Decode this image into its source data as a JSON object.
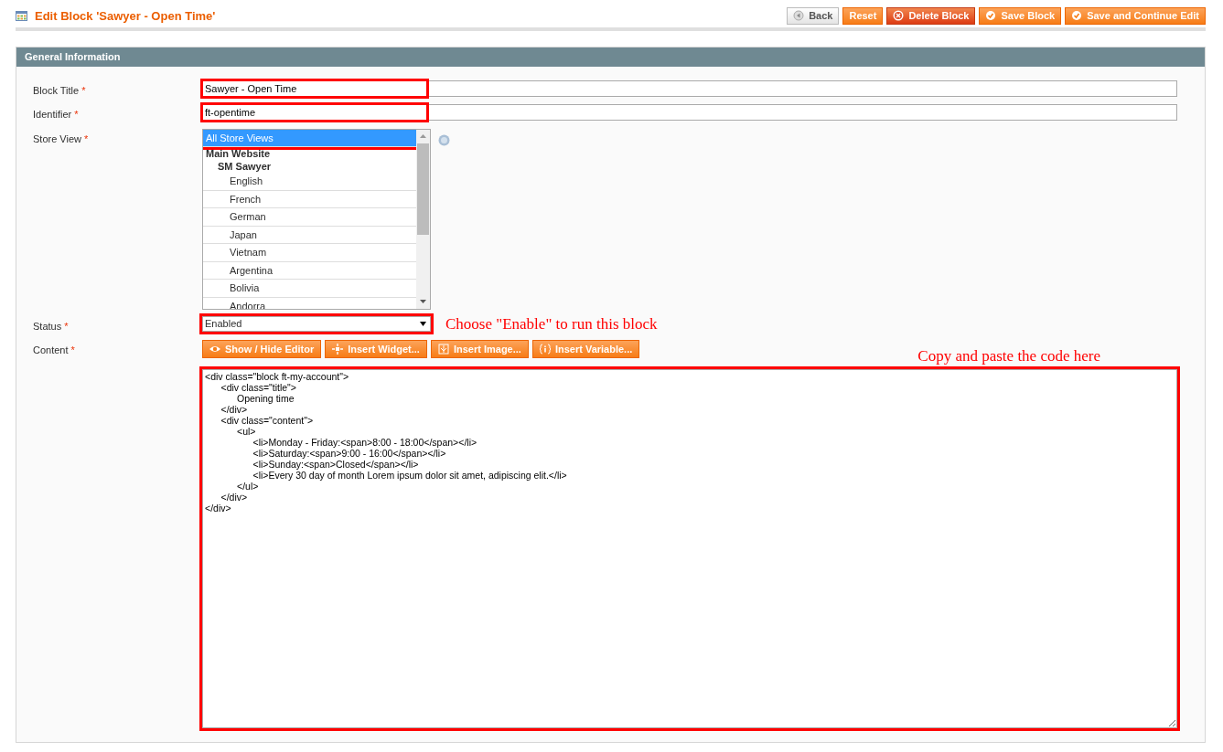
{
  "page": {
    "title": "Edit Block 'Sawyer - Open Time'"
  },
  "header_buttons": [
    {
      "label": "Back",
      "kind": "back"
    },
    {
      "label": "Reset",
      "kind": "plain"
    },
    {
      "label": "Delete Block",
      "kind": "delete"
    },
    {
      "label": "Save Block",
      "kind": "save"
    },
    {
      "label": "Save and Continue Edit",
      "kind": "save"
    }
  ],
  "section": {
    "title": "General Information",
    "fields": [
      {
        "kind": "text",
        "label": "Block Title",
        "required": "*",
        "value": "Sawyer - Open Time",
        "highlighted": true
      },
      {
        "kind": "text",
        "label": "Identifier",
        "required": "*",
        "value": "ft-opentime",
        "highlighted": true
      },
      {
        "kind": "multiselect",
        "label": "Store View",
        "required": "*",
        "options": [
          {
            "label": "All Store Views",
            "selected": true,
            "highlighted": true
          },
          {
            "label": "Main Website",
            "kind": "group",
            "children": [
              {
                "label": "SM Sawyer",
                "kind": "group",
                "children": [
                  {
                    "label": "English",
                    "selected": false
                  },
                  {
                    "label": "French",
                    "selected": false
                  },
                  {
                    "label": "German",
                    "selected": false
                  },
                  {
                    "label": "Japan",
                    "selected": false
                  },
                  {
                    "label": "Vietnam",
                    "selected": false
                  },
                  {
                    "label": "Argentina",
                    "selected": false
                  },
                  {
                    "label": "Bolivia",
                    "selected": false
                  },
                  {
                    "label": "Andorra",
                    "selected": false
                  }
                ]
              }
            ]
          }
        ]
      },
      {
        "kind": "select",
        "label": "Status",
        "required": "*",
        "value": "Enabled",
        "highlighted": true,
        "annotation": "Choose \"Enable\" to run this block"
      },
      {
        "kind": "editor",
        "label": "Content",
        "required": "*",
        "highlighted": true,
        "annotation": "Copy and paste the code here",
        "buttons": [
          {
            "label": "Show / Hide Editor"
          },
          {
            "label": "Insert Widget..."
          },
          {
            "label": "Insert Image..."
          },
          {
            "label": "Insert Variable..."
          }
        ],
        "value": "<div class=\"block ft-my-account\">\n\t<div class=\"title\">\n\t\tOpening time\n\t</div>\n\t<div class=\"content\">\n\t\t<ul>\n\t\t\t<li>Monday - Friday:<span>8:00 - 18:00</span></li>\n\t\t\t<li>Saturday:<span>9:00 - 16:00</span></li>\n\t\t\t<li>Sunday:<span>Closed</span></li>\n\t\t\t<li>Every 30 day of month Lorem ipsum dolor sit amet, adipiscing elit.</li>\n\t\t</ul>\n\t</div>\n</div>"
      }
    ]
  }
}
